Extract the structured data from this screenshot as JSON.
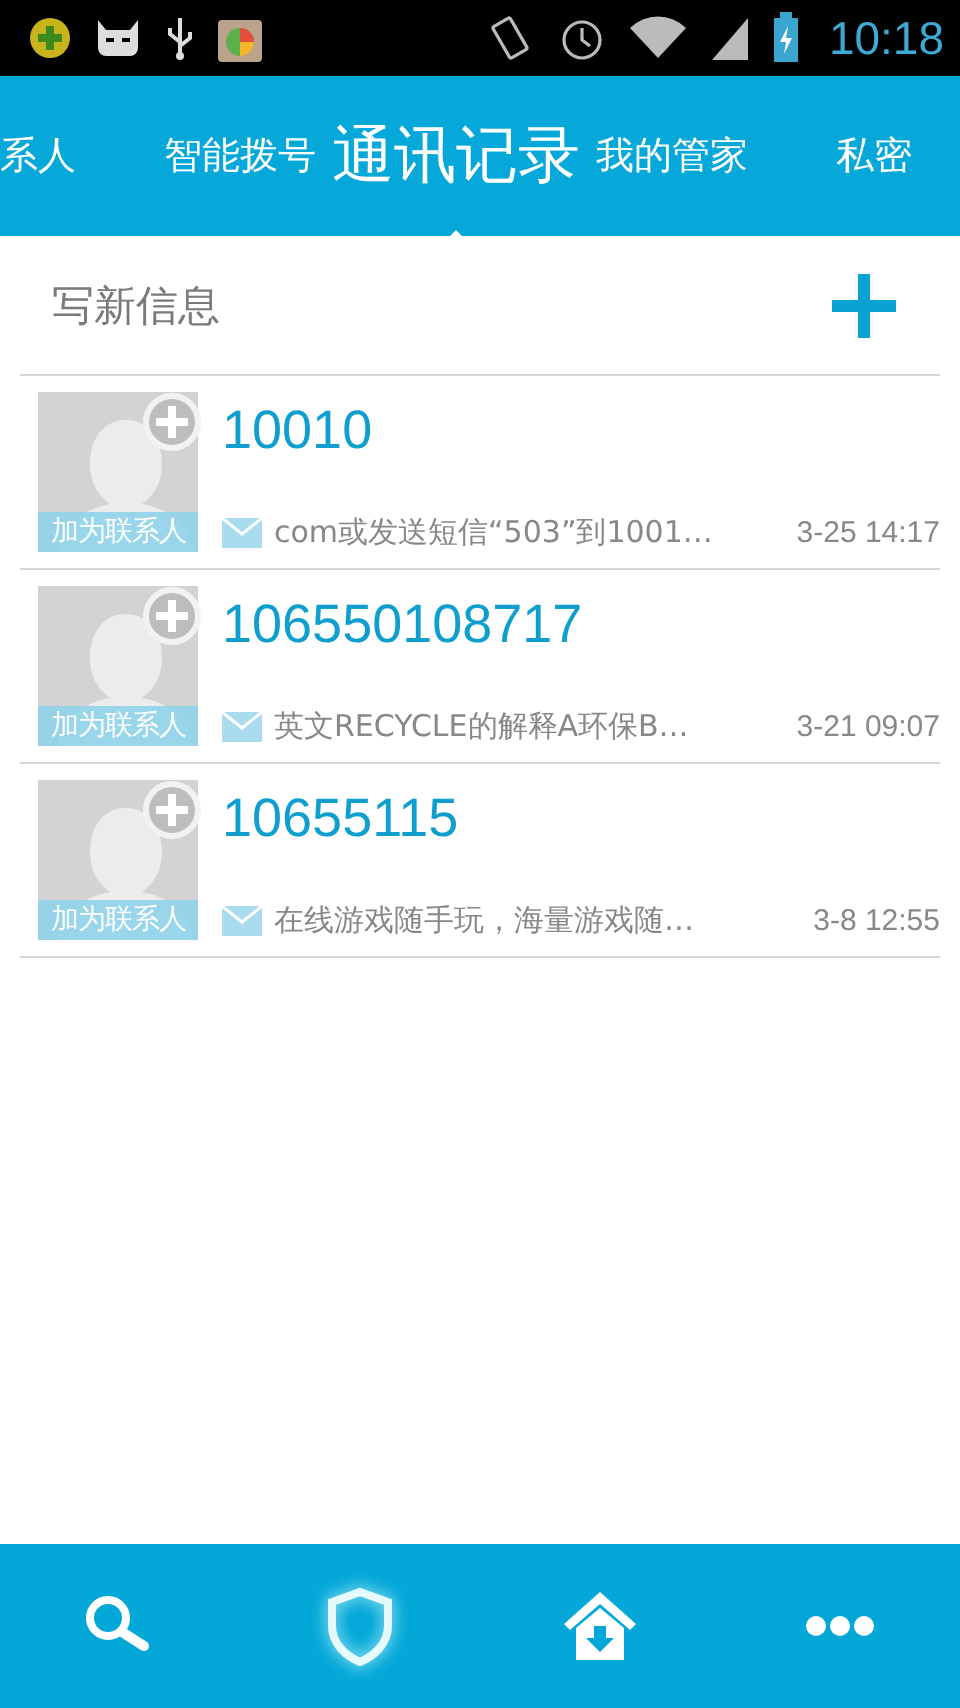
{
  "status_bar": {
    "time": "10:18"
  },
  "tabs": [
    {
      "label": "系人",
      "selected": false
    },
    {
      "label": "智能拨号",
      "selected": false
    },
    {
      "label": "通讯记录",
      "selected": true
    },
    {
      "label": "我的管家",
      "selected": false
    },
    {
      "label": "私密",
      "selected": false
    }
  ],
  "compose": {
    "label": "写新信息"
  },
  "messages": [
    {
      "sender": "10010",
      "avatar_label": "加为联系人",
      "preview": "com或发送短信“503”到1001…",
      "time": "3-25 14:17"
    },
    {
      "sender": "106550108717",
      "avatar_label": "加为联系人",
      "preview": "英文RECYCLE的解释A环保B…",
      "time": "3-21 09:07"
    },
    {
      "sender": "10655115",
      "avatar_label": "加为联系人",
      "preview": "在线游戏随手玩，海量游戏随…",
      "time": "3-8 12:55"
    }
  ],
  "bottom_bar": [
    {
      "kind": "search",
      "selected": false
    },
    {
      "kind": "shield",
      "selected": true
    },
    {
      "kind": "home",
      "selected": false
    },
    {
      "kind": "more",
      "selected": false
    }
  ]
}
